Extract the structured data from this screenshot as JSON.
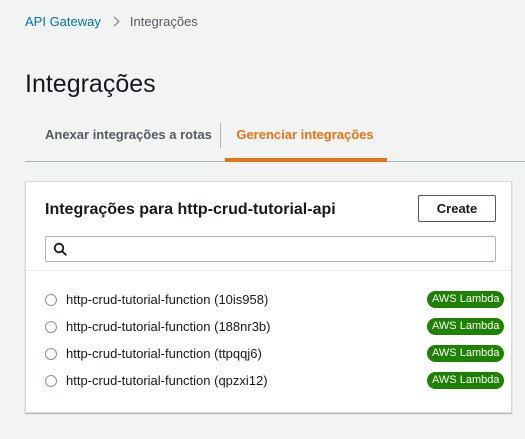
{
  "breadcrumb": {
    "root": "API Gateway",
    "current": "Integrações"
  },
  "page": {
    "title": "Integrações"
  },
  "tabs": [
    {
      "label": "Anexar integrações a rotas",
      "active": false
    },
    {
      "label": "Gerenciar integrações",
      "active": true
    }
  ],
  "panel": {
    "title": "Integrações para http-crud-tutorial-api",
    "create_label": "Create",
    "search": {
      "value": "",
      "placeholder": ""
    }
  },
  "integrations": [
    {
      "label": "http-crud-tutorial-function (10is958)",
      "badge": "AWS Lambda"
    },
    {
      "label": "http-crud-tutorial-function (188nr3b)",
      "badge": "AWS Lambda"
    },
    {
      "label": "http-crud-tutorial-function (ttpqqj6)",
      "badge": "AWS Lambda"
    },
    {
      "label": "http-crud-tutorial-function (qpzxi12)",
      "badge": "AWS Lambda"
    }
  ],
  "colors": {
    "link": "#0073bb",
    "active_tab": "#ec7211",
    "badge_bg": "#1d8102"
  }
}
